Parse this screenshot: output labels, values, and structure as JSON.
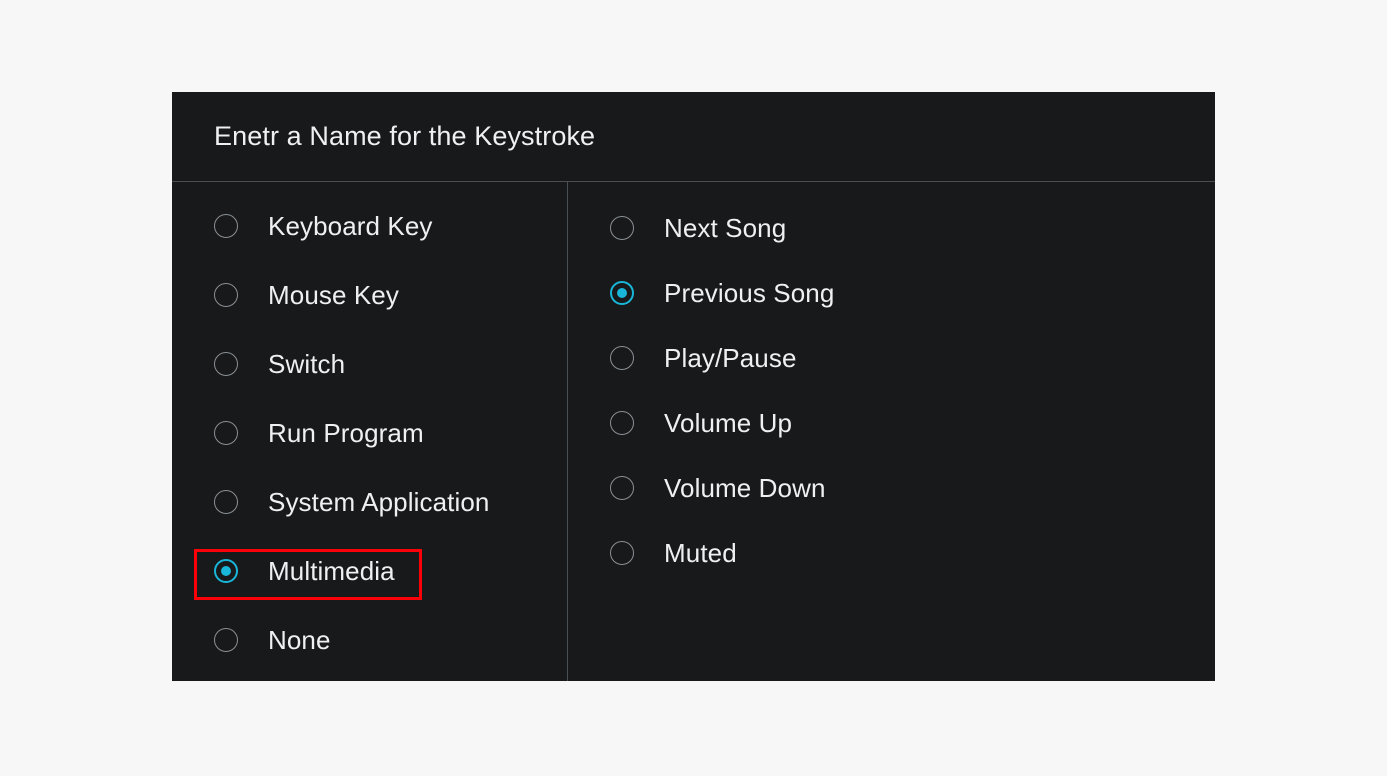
{
  "page": {
    "background_color": "#f7f7f7"
  },
  "dialog": {
    "background_color": "#17191b",
    "divider_color": "#4a4f53",
    "title": "Enetr a Name for the Keystroke",
    "accent_color": "#19b6d9",
    "text_color": "#eef0f1",
    "radio_outline_color": "#8b9094"
  },
  "left_column": {
    "name": "keystroke-type-options",
    "options": [
      {
        "label": "Keyboard Key",
        "selected": false
      },
      {
        "label": "Mouse Key",
        "selected": false
      },
      {
        "label": "Switch",
        "selected": false
      },
      {
        "label": "Run Program",
        "selected": false
      },
      {
        "label": "System Application",
        "selected": false
      },
      {
        "label": "Multimedia",
        "selected": true
      },
      {
        "label": "None",
        "selected": false
      }
    ]
  },
  "right_column": {
    "name": "multimedia-action-options",
    "options": [
      {
        "label": "Next Song",
        "selected": false
      },
      {
        "label": "Previous Song",
        "selected": true
      },
      {
        "label": "Play/Pause",
        "selected": false
      },
      {
        "label": "Volume Up",
        "selected": false
      },
      {
        "label": "Volume Down",
        "selected": false
      },
      {
        "label": "Muted",
        "selected": false
      }
    ]
  },
  "annotation": {
    "target_label": "Multimedia",
    "color": "#fb0007"
  }
}
